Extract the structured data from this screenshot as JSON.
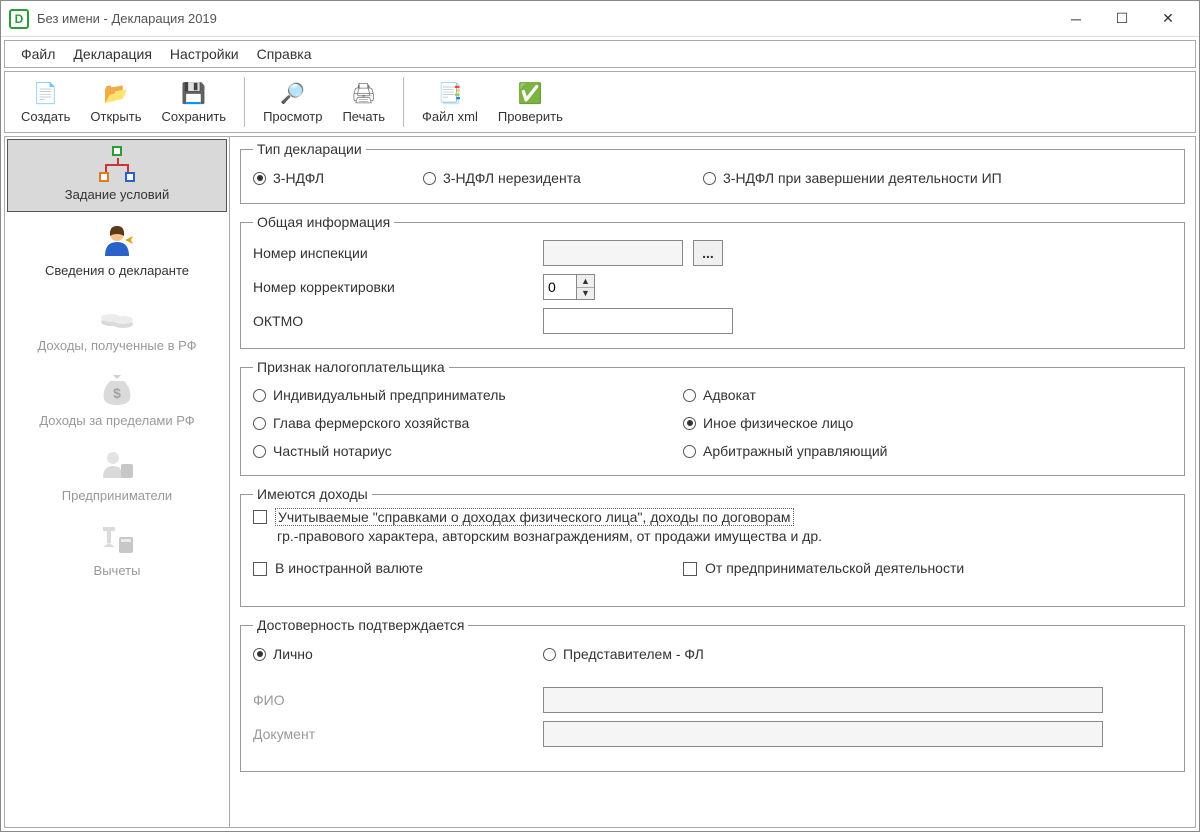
{
  "window": {
    "title": "Без имени - Декларация 2019"
  },
  "menubar": [
    "Файл",
    "Декларация",
    "Настройки",
    "Справка"
  ],
  "toolbar": {
    "create": "Создать",
    "open": "Открыть",
    "save": "Сохранить",
    "preview": "Просмотр",
    "print": "Печать",
    "xml": "Файл xml",
    "check": "Проверить"
  },
  "sidebar": {
    "items": [
      {
        "label": "Задание условий",
        "active": true,
        "disabled": false,
        "icon": "diagram"
      },
      {
        "label": "Сведения о декларанте",
        "active": false,
        "disabled": false,
        "icon": "person"
      },
      {
        "label": "Доходы, полученные в РФ",
        "active": false,
        "disabled": true,
        "icon": "coins"
      },
      {
        "label": "Доходы за пределами РФ",
        "active": false,
        "disabled": true,
        "icon": "bag"
      },
      {
        "label": "Предприниматели",
        "active": false,
        "disabled": true,
        "icon": "entrepreneur"
      },
      {
        "label": "Вычеты",
        "active": false,
        "disabled": true,
        "icon": "deductions"
      }
    ]
  },
  "form": {
    "decl_type": {
      "legend": "Тип декларации",
      "options": [
        {
          "label": "3-НДФЛ",
          "checked": true
        },
        {
          "label": "3-НДФЛ нерезидента",
          "checked": false
        },
        {
          "label": "3-НДФЛ при завершении деятельности ИП",
          "checked": false
        }
      ]
    },
    "general": {
      "legend": "Общая информация",
      "inspection_label": "Номер инспекции",
      "inspection_value": "",
      "inspection_btn": "...",
      "correction_label": "Номер корректировки",
      "correction_value": "0",
      "oktmo_label": "ОКТМО",
      "oktmo_value": ""
    },
    "taxpayer": {
      "legend": "Признак налогоплательщика",
      "options": [
        {
          "label": "Индивидуальный предприниматель",
          "checked": false
        },
        {
          "label": "Адвокат",
          "checked": false
        },
        {
          "label": "Глава фермерского хозяйства",
          "checked": false
        },
        {
          "label": "Иное физическое лицо",
          "checked": true
        },
        {
          "label": "Частный нотариус",
          "checked": false
        },
        {
          "label": "Арбитражный управляющий",
          "checked": false
        }
      ]
    },
    "income": {
      "legend": "Имеются доходы",
      "opt1_line1": "Учитываемые \"справками о доходах физического лица\", доходы по договорам",
      "opt1_line2": "гр.-правового характера, авторским вознаграждениям, от продажи имущества и др.",
      "opt1_checked": false,
      "opt2_label": "В иностранной валюте",
      "opt2_checked": false,
      "opt3_label": "От предпринимательской деятельности",
      "opt3_checked": false
    },
    "auth": {
      "legend": "Достоверность подтверждается",
      "opt_self": "Лично",
      "opt_rep": "Представителем - ФЛ",
      "selected": "self",
      "fio_label": "ФИО",
      "fio_value": "",
      "doc_label": "Документ",
      "doc_value": ""
    }
  }
}
